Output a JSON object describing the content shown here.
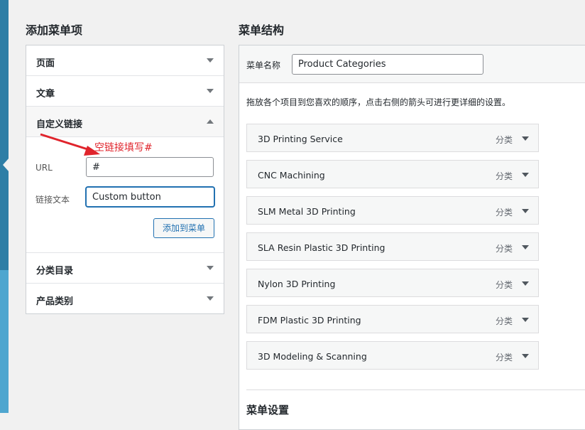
{
  "left": {
    "heading": "添加菜单项",
    "sections": [
      {
        "label": "页面",
        "expanded": false
      },
      {
        "label": "文章",
        "expanded": false
      },
      {
        "label": "自定义链接",
        "expanded": true
      },
      {
        "label": "分类目录",
        "expanded": false
      },
      {
        "label": "产品类别",
        "expanded": false
      }
    ],
    "custom_link": {
      "annotation": "空链接填写#",
      "url_label": "URL",
      "url_value": "#",
      "text_label": "链接文本",
      "text_value": "Custom button",
      "add_button": "添加到菜单"
    }
  },
  "right": {
    "heading": "菜单结构",
    "menu_name_label": "菜单名称",
    "menu_name_value": "Product Categories",
    "instructions": "拖放各个项目到您喜欢的顺序，点击右侧的箭头可进行更详细的设置。",
    "items": [
      {
        "title": "3D Printing Service",
        "type": "分类"
      },
      {
        "title": "CNC Machining",
        "type": "分类"
      },
      {
        "title": "SLM Metal 3D Printing",
        "type": "分类"
      },
      {
        "title": "SLA Resin Plastic 3D Printing",
        "type": "分类"
      },
      {
        "title": "Nylon 3D Printing",
        "type": "分类"
      },
      {
        "title": "FDM Plastic 3D Printing",
        "type": "分类"
      },
      {
        "title": "3D Modeling & Scanning",
        "type": "分类"
      }
    ],
    "settings_heading": "菜单设置"
  },
  "colors": {
    "accent": "#2271b1",
    "annotation": "#e0242c",
    "admin_bar": "#4fa6cf"
  }
}
